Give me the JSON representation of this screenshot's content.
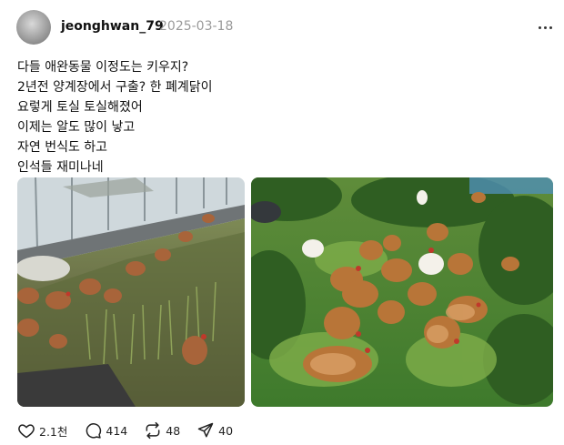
{
  "post": {
    "username": "jeonghwan_79",
    "date": "2025-03-18",
    "lines": [
      "다들 애완동물 이정도는 키우지?",
      "2년전 양계장에서 구출? 한 폐계닭이",
      "요렇게 토실 토실해졌어",
      "이제는 알도 많이 낳고",
      "자연 번식도 하고",
      "인석들 재미나네"
    ],
    "images": [
      {
        "icon": "greenhouse-chickens-photo"
      },
      {
        "icon": "chickens-on-grass-photo"
      }
    ]
  },
  "actions": {
    "like_count": "2.1천",
    "comment_count": "414",
    "repost_count": "48",
    "share_count": "40"
  }
}
